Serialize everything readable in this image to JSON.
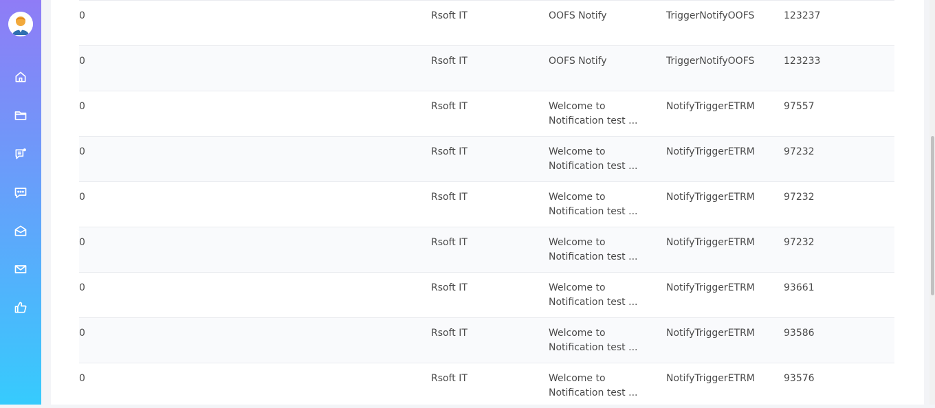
{
  "sidebar": {
    "icons": [
      "home-icon",
      "folder-icon",
      "notification-list-icon",
      "chat-icon",
      "open-mail-icon",
      "mail-icon",
      "thumbs-up-icon"
    ]
  },
  "table": {
    "rows": [
      {
        "col0": "0",
        "group": "Rsoft IT",
        "message_line1": "OOFS Notify",
        "message_line2": "",
        "trigger": "TriggerNotifyOOFS",
        "id": "123237"
      },
      {
        "col0": "0",
        "group": "Rsoft IT",
        "message_line1": "OOFS Notify",
        "message_line2": "",
        "trigger": "TriggerNotifyOOFS",
        "id": "123233"
      },
      {
        "col0": "0",
        "group": "Rsoft IT",
        "message_line1": "Welcome to",
        "message_line2": "Notification test ...",
        "trigger": "NotifyTriggerETRM",
        "id": "97557"
      },
      {
        "col0": "0",
        "group": "Rsoft IT",
        "message_line1": "Welcome to",
        "message_line2": "Notification test ...",
        "trigger": "NotifyTriggerETRM",
        "id": "97232"
      },
      {
        "col0": "0",
        "group": "Rsoft IT",
        "message_line1": "Welcome to",
        "message_line2": "Notification test ...",
        "trigger": "NotifyTriggerETRM",
        "id": "97232"
      },
      {
        "col0": "0",
        "group": "Rsoft IT",
        "message_line1": "Welcome to",
        "message_line2": "Notification test ...",
        "trigger": "NotifyTriggerETRM",
        "id": "97232"
      },
      {
        "col0": "0",
        "group": "Rsoft IT",
        "message_line1": "Welcome to",
        "message_line2": "Notification test ...",
        "trigger": "NotifyTriggerETRM",
        "id": "93661"
      },
      {
        "col0": "0",
        "group": "Rsoft IT",
        "message_line1": "Welcome to",
        "message_line2": "Notification test ...",
        "trigger": "NotifyTriggerETRM",
        "id": "93586"
      },
      {
        "col0": "0",
        "group": "Rsoft IT",
        "message_line1": "Welcome to",
        "message_line2": "Notification test ...",
        "trigger": "NotifyTriggerETRM",
        "id": "93576"
      }
    ]
  },
  "colors": {
    "sidebar_top": "#8f7cf6",
    "sidebar_bottom": "#36cbfd",
    "row_alt": "#f9fafc"
  }
}
